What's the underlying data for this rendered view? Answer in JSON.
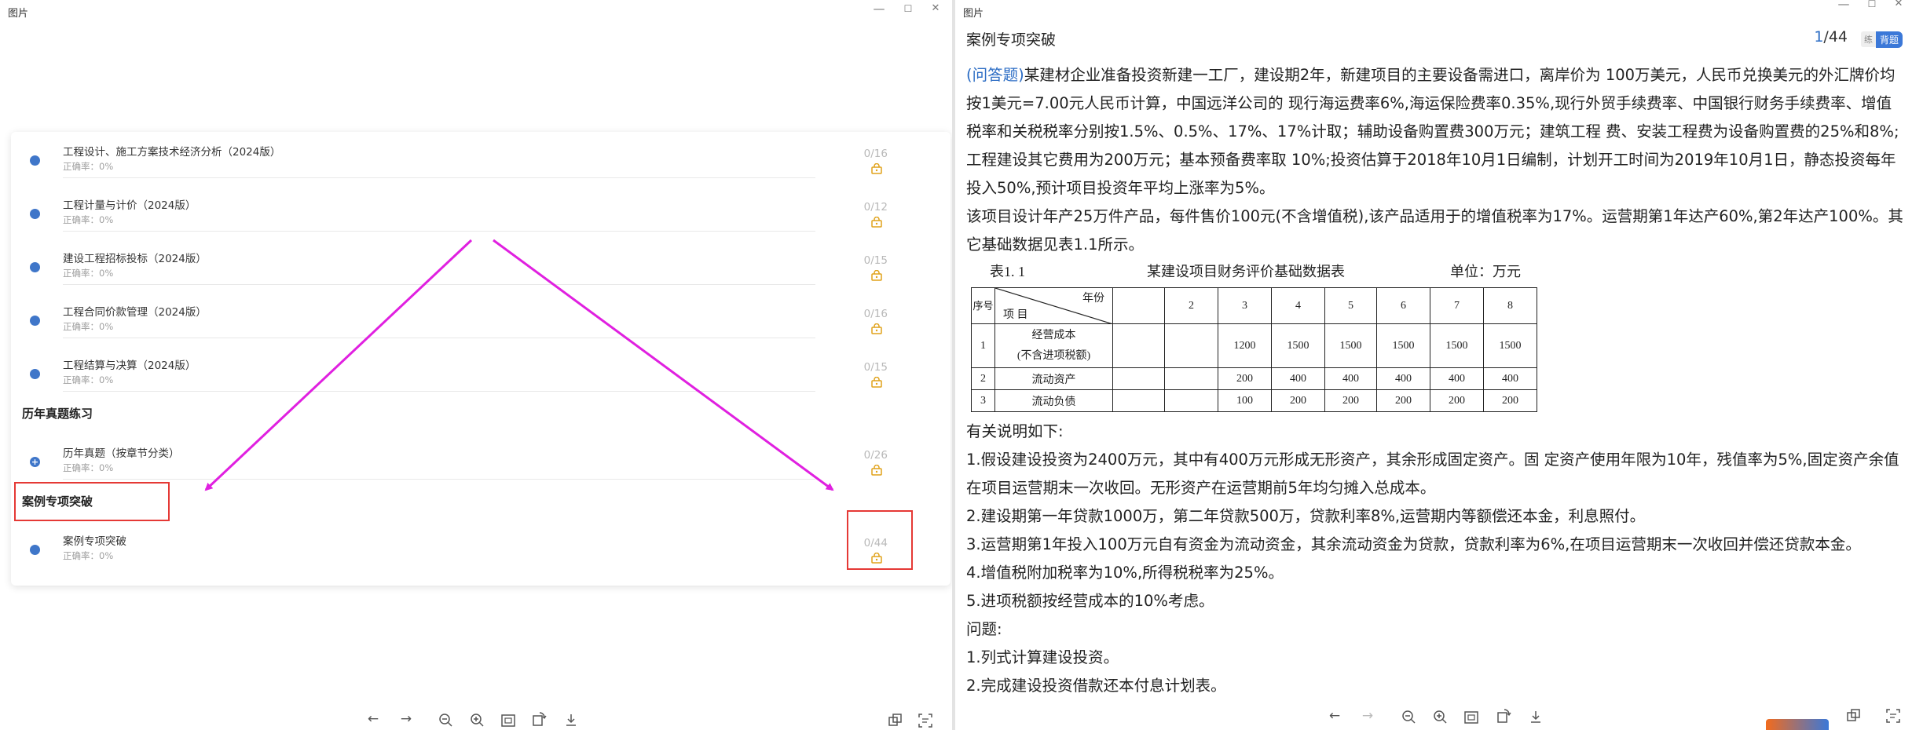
{
  "left": {
    "title": "图片",
    "window_controls": [
      "—",
      "☐",
      "✕"
    ],
    "sections": [
      {
        "heading": "历年真题练习"
      },
      {
        "heading": "案例专项突破"
      }
    ],
    "items": [
      {
        "title": "工程设计、施工方案技术经济分析（2024版）",
        "sub": "正确率：0%",
        "count": "0/16"
      },
      {
        "title": "工程计量与计价（2024版）",
        "sub": "正确率：0%",
        "count": "0/12"
      },
      {
        "title": "建设工程招标投标（2024版）",
        "sub": "正确率：0%",
        "count": "0/15"
      },
      {
        "title": "工程合同价款管理（2024版）",
        "sub": "正确率：0%",
        "count": "0/16"
      },
      {
        "title": "工程结算与决算（2024版）",
        "sub": "正确率：0%",
        "count": "0/15"
      },
      {
        "title": "历年真题（按章节分类）",
        "sub": "正确率：0%",
        "count": "0/26"
      },
      {
        "title": "案例专项突破",
        "sub": "正确率：0%",
        "count": "0/44"
      }
    ],
    "toolbar": [
      "←",
      "→",
      "zoom-out",
      "zoom-in",
      "fit",
      "rotate",
      "download"
    ],
    "colors": {
      "accent": "#3f76c9",
      "arrow": "#e020e0",
      "highlight": "#e53935"
    }
  },
  "right": {
    "title": "图片",
    "heading": "案例专项突破",
    "page_current": "1",
    "page_total": "/44",
    "badge_mode": "练",
    "badge_recite": "背题",
    "q_tag": "(问答题)",
    "para1": "某建材企业准备投资新建一工厂，建设期2年，新建项目的主要设备需进口，离岸价为 100万美元，人民币兑换美元的外汇牌价均按1美元=7.00元人民币计算，中国远洋公司的 现行海运费率6%,海运保险费率0.35%,现行外贸手续费率、中国银行财务手续费率、增值 税率和关税税率分别按1.5%、0.5%、17%、17%计取；辅助设备购置费300万元；建筑工程 费、安装工程费为设备购置费的25%和8%;工程建设其它费用为200万元；基本预备费率取 10%;投资估算于2018年10月1日编制，计划开工时间为2019年10月1日，静态投资每年投入50%,预计项目投资年平均上涨率为5%。",
    "para2": "该项目设计年产25万件产品，每件售价100元(不含增值税),该产品适用于的增值税率为17%。运营期第1年达产60%,第2年达产100%。其它基础数据见表1.1所示。",
    "table": {
      "caption_no": "表1. 1",
      "caption_title": "某建设项目财务评价基础数据表",
      "caption_unit": "单位：万元",
      "h_seq": "序号",
      "h_year": "年份",
      "h_item": "项 目",
      "years": [
        "",
        "2",
        "3",
        "4",
        "5",
        "6",
        "7",
        "8"
      ],
      "rows": [
        {
          "no": "1",
          "name": "经营成本",
          "name2": "(不含进项税额)",
          "vals": [
            "",
            "",
            "1200",
            "1500",
            "1500",
            "1500",
            "1500",
            "1500"
          ]
        },
        {
          "no": "2",
          "name": "流动资产",
          "name2": "",
          "vals": [
            "",
            "",
            "200",
            "400",
            "400",
            "400",
            "400",
            "400"
          ]
        },
        {
          "no": "3",
          "name": "流动负债",
          "name2": "",
          "vals": [
            "",
            "",
            "100",
            "200",
            "200",
            "200",
            "200",
            "200"
          ]
        }
      ]
    },
    "notes_title": "有关说明如下:",
    "notes": [
      "1.假设建设投资为2400万元，其中有400万元形成无形资产，其余形成固定资产。固 定资产使用年限为10年，残值率为5%,固定资产余值在项目运营期末一次收回。无形资产在运营期前5年均匀摊入总成本。",
      "2.建设期第一年贷款1000万，第二年贷款500万，贷款利率8%,运营期内等额偿还本金，利息照付。",
      "3.运营期第1年投入100万元自有资金为流动资金，其余流动资金为贷款，贷款利率为6%,在项目运营期末一次收回并偿还贷款本金。",
      "4.增值税附加税率为10%,所得税税率为25%。",
      "5.进项税额按经营成本的10%考虑。"
    ],
    "questions_title": "问题:",
    "questions": [
      "1.列式计算建设投资。",
      "2.完成建设投资借款还本付息计划表。"
    ]
  }
}
